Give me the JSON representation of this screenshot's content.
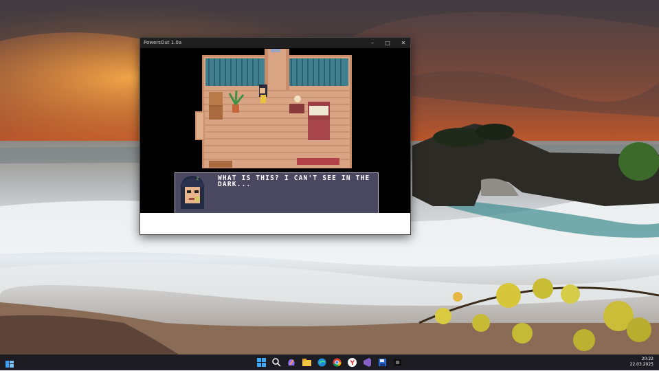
{
  "window": {
    "title": "PowersOut 1.0a",
    "minimize_icon": "minimize-icon",
    "maximize_icon": "maximize-icon",
    "close_icon": "close-icon"
  },
  "dialog": {
    "text": "WHAT IS THIS? I CAN'T SEE IN THE DARK..."
  },
  "taskbar": {
    "time": "20:22",
    "date": "22.03.2025",
    "icons": [
      "widgets-icon",
      "start-icon",
      "search-icon",
      "copilot-icon",
      "file-explorer-icon",
      "edge-icon",
      "chrome-icon",
      "yandex-icon",
      "visual-studio-icon",
      "floppy-save-icon",
      "game-app-icon"
    ]
  },
  "colors": {
    "taskbar_bg": "#1c1c22",
    "titlebar_bg": "#1f1f1f",
    "dialog_bg": "#4a4860"
  }
}
